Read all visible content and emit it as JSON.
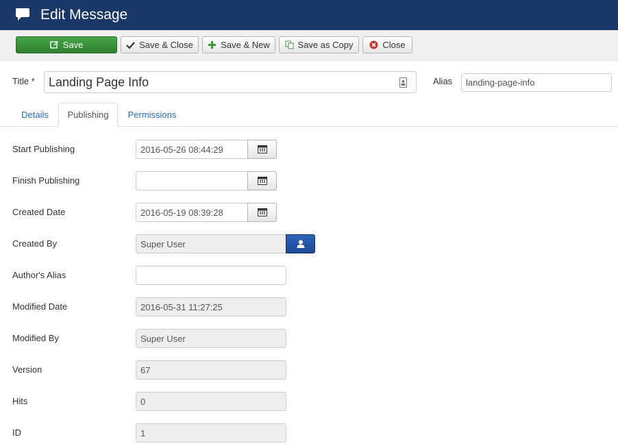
{
  "header": {
    "title": "Edit Message",
    "icon": "comment-icon"
  },
  "toolbar": {
    "save": "Save",
    "save_close": "Save & Close",
    "save_new": "Save & New",
    "save_copy": "Save as Copy",
    "close": "Close"
  },
  "title_field": {
    "label": "Title *",
    "value": "Landing Page Info"
  },
  "alias_field": {
    "label": "Alias",
    "value": "landing-page-info"
  },
  "tabs": {
    "details": "Details",
    "publishing": "Publishing",
    "permissions": "Permissions",
    "active": "Publishing"
  },
  "fields": {
    "start_publishing": {
      "label": "Start Publishing",
      "value": "2016-05-26 08:44:29"
    },
    "finish_publishing": {
      "label": "Finish Publishing",
      "value": ""
    },
    "created_date": {
      "label": "Created Date",
      "value": "2016-05-19 08:39:28"
    },
    "created_by": {
      "label": "Created By",
      "value": "Super User"
    },
    "authors_alias": {
      "label": "Author's Alias",
      "value": ""
    },
    "modified_date": {
      "label": "Modified Date",
      "value": "2016-05-31 11:27:25"
    },
    "modified_by": {
      "label": "Modified By",
      "value": "Super User"
    },
    "version": {
      "label": "Version",
      "value": "67"
    },
    "hits": {
      "label": "Hits",
      "value": "0"
    },
    "id": {
      "label": "ID",
      "value": "1"
    }
  },
  "colors": {
    "header_bg": "#1a3867",
    "save_green": "#3d943d",
    "link_blue": "#2a69b8",
    "user_button": "#2456a6"
  }
}
